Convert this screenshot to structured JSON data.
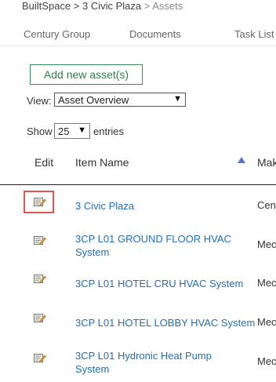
{
  "breadcrumb": {
    "root": "BuiltSpace",
    "sep1": ">",
    "site": "3 Civic Plaza",
    "sep2": ">",
    "current": "Assets"
  },
  "topnav": {
    "tabs": [
      "Century Group",
      "Documents",
      "Task List"
    ]
  },
  "toolbar": {
    "add_label": "Add new asset(s)",
    "view_label": "View:",
    "view_value": "Asset Overview",
    "show_label": "Show",
    "show_value": "25",
    "entries_label": "entries"
  },
  "table": {
    "headers": {
      "edit": "Edit",
      "item_name": "Item Name",
      "make": "Mak"
    },
    "rows": [
      {
        "name": "3 Civic Plaza",
        "make": "Cent"
      },
      {
        "name": "3CP L01 GROUND FLOOR HVAC System",
        "make": "Mec"
      },
      {
        "name": "3CP L01 HOTEL CRU HVAC System",
        "make": "Mec"
      },
      {
        "name": "3CP L01 HOTEL LOBBY HVAC System",
        "make": "Mec"
      },
      {
        "name": "3CP L01 Hydronic Heat Pump System",
        "make": "Mec"
      }
    ]
  },
  "colors": {
    "link": "#1f6fb5",
    "add_button_border": "#3c8c5c",
    "highlight": "#e05555",
    "sort_indicator": "#5b6fd6"
  },
  "icons": {
    "edit": "pencil-paper-icon",
    "sort": "triangle-up-icon",
    "select_caret": "caret-down-icon"
  }
}
